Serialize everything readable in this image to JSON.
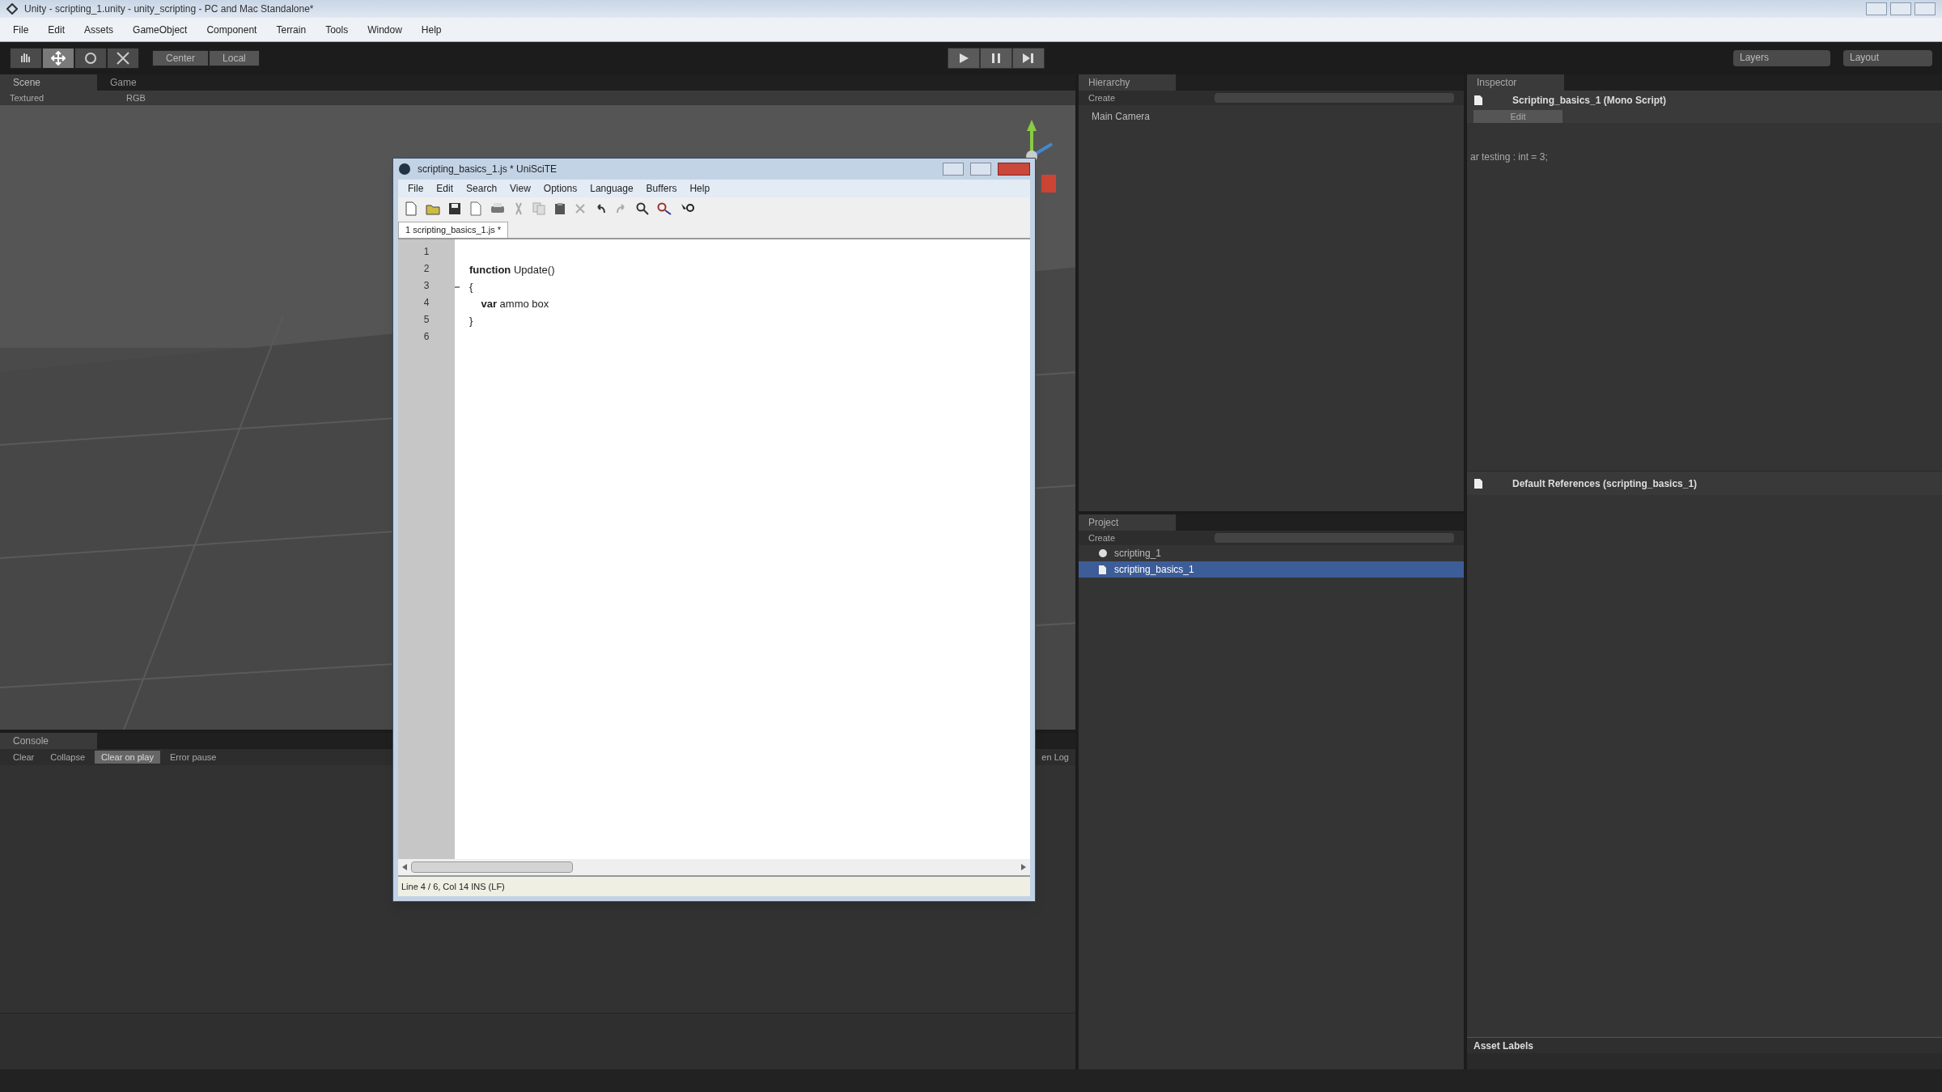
{
  "window": {
    "title": "Unity - scripting_1.unity - unity_scripting - PC and Mac Standalone*"
  },
  "menu": [
    "File",
    "Edit",
    "Assets",
    "GameObject",
    "Component",
    "Terrain",
    "Tools",
    "Window",
    "Help"
  ],
  "toolbar": {
    "tools": [
      {
        "kind": "hand",
        "selected": false
      },
      {
        "kind": "move",
        "selected": true
      },
      {
        "kind": "rotate",
        "selected": false
      },
      {
        "kind": "scale",
        "selected": false
      }
    ],
    "pivot": [
      "Center",
      "Local"
    ],
    "layers": "Layers",
    "layout": "Layout"
  },
  "scene_panel": {
    "tabs": [
      {
        "label": "Scene",
        "selected": true
      },
      {
        "label": "Game",
        "selected": false
      }
    ],
    "toolbar": [
      "Textured",
      "RGB"
    ]
  },
  "console": {
    "tab": "Console",
    "buttons": [
      {
        "label": "Clear",
        "selected": false
      },
      {
        "label": "Collapse",
        "selected": false
      },
      {
        "label": "Clear on play",
        "selected": true
      },
      {
        "label": "Error pause",
        "selected": false
      }
    ],
    "right_text": "en Log"
  },
  "hierarchy": {
    "tab": "Hierarchy",
    "create": "Create",
    "items": [
      {
        "label": "Main Camera",
        "selected": false
      }
    ]
  },
  "project": {
    "tab": "Project",
    "create": "Create",
    "items": [
      {
        "label": "scripting_1",
        "kind": "scene",
        "selected": false
      },
      {
        "label": "scripting_basics_1",
        "kind": "script",
        "selected": true
      }
    ]
  },
  "inspector": {
    "tab": "Inspector",
    "header": "Scripting_basics_1 (Mono Script)",
    "edit_button": "Edit",
    "source": "ar testing : int = 3;",
    "references": "Default References (scripting_basics_1)",
    "asset_labels": "Asset Labels"
  },
  "editor": {
    "title": "scripting_basics_1.js * UniSciTE",
    "menu": [
      "File",
      "Edit",
      "Search",
      "View",
      "Options",
      "Language",
      "Buffers",
      "Help"
    ],
    "tab": "1 scripting_basics_1.js *",
    "lines": [
      {
        "number": "1",
        "fold": false
      },
      {
        "number": "2",
        "code": "**function** Update()",
        "fold": false
      },
      {
        "number": "3",
        "code": "{",
        "fold": true
      },
      {
        "number": "4",
        "code": "    **var** ammo box",
        "fold": false
      },
      {
        "number": "5",
        "code": "}",
        "fold": false
      },
      {
        "number": "6",
        "fold": false
      }
    ],
    "status": "Line 4 / 6, Col 14 INS (LF)"
  }
}
